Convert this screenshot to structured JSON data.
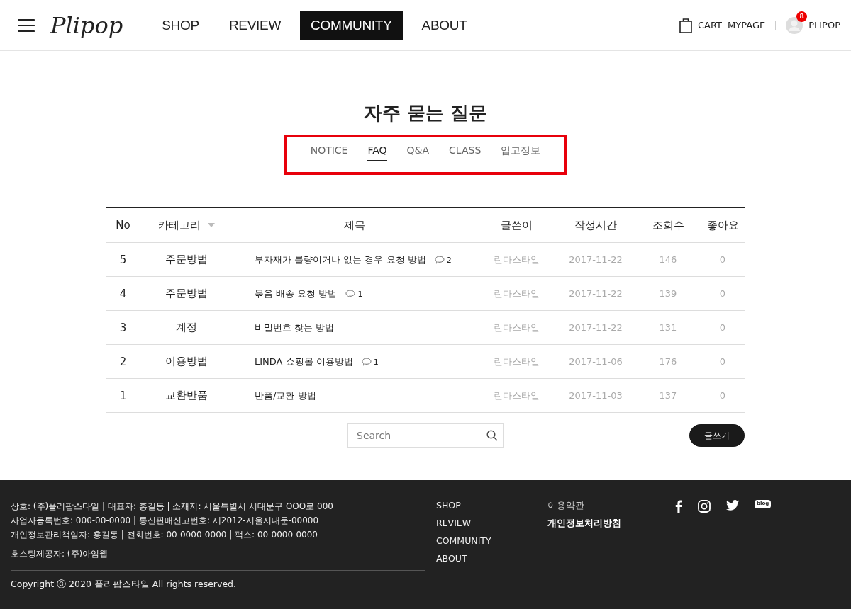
{
  "header": {
    "logo": "Plipop",
    "nav": [
      {
        "label": "SHOP",
        "selected": false
      },
      {
        "label": "REVIEW",
        "selected": false
      },
      {
        "label": "COMMUNITY",
        "selected": true
      },
      {
        "label": "ABOUT",
        "selected": false
      }
    ],
    "cart": "CART",
    "mypage": "MYPAGE",
    "user": "PLIPOP",
    "badge": "8"
  },
  "page": {
    "title": "자주 묻는 질문",
    "tabs": [
      {
        "label": "NOTICE",
        "selected": false
      },
      {
        "label": "FAQ",
        "selected": true
      },
      {
        "label": "Q&A",
        "selected": false
      },
      {
        "label": "CLASS",
        "selected": false
      },
      {
        "label": "입고정보",
        "selected": false
      }
    ]
  },
  "table": {
    "columns": [
      "No",
      "카테고리",
      "제목",
      "글쓴이",
      "작성시간",
      "조회수",
      "좋아요"
    ],
    "rows": [
      {
        "no": "5",
        "category": "주문방법",
        "title": "부자재가 불량이거나 없는 경우 요청 방법",
        "comments": "2",
        "author": "린다스타일",
        "date": "2017-11-22",
        "views": "146",
        "likes": "0"
      },
      {
        "no": "4",
        "category": "주문방법",
        "title": "묶음 배송 요청 방법",
        "comments": "1",
        "author": "린다스타일",
        "date": "2017-11-22",
        "views": "139",
        "likes": "0"
      },
      {
        "no": "3",
        "category": "계정",
        "title": "비밀번호 찾는 방법",
        "author": "린다스타일",
        "date": "2017-11-22",
        "views": "131",
        "likes": "0"
      },
      {
        "no": "2",
        "category": "이용방법",
        "title": "LINDA 쇼핑몰 이용방법",
        "comments": "1",
        "author": "린다스타일",
        "date": "2017-11-06",
        "views": "176",
        "likes": "0"
      },
      {
        "no": "1",
        "category": "교환반품",
        "title": "반품/교환 방법",
        "author": "린다스타일",
        "date": "2017-11-03",
        "views": "137",
        "likes": "0"
      }
    ]
  },
  "search": {
    "placeholder": "Search"
  },
  "write_button": "글쓰기",
  "footer": {
    "info": [
      "상호: (주)플리팝스타일 | 대표자: 홍길동 | 소재지: 서울특별시 서대문구 OOO로 000",
      "사업자등록번호: 000-00-0000 | 통신판매신고번호: 제2012-서울서대문-00000",
      "개인정보관리책임자: 홍길동 | 전화번호: 00-0000-0000 | 팩스: 00-0000-0000"
    ],
    "hosting": "호스팅제공자: (주)아임웹",
    "copyright": "Copyright ⓒ 2020 플리팝스타일 All rights reserved.",
    "nav": [
      "SHOP",
      "REVIEW",
      "COMMUNITY",
      "ABOUT"
    ],
    "policies": [
      {
        "label": "이용약관",
        "bold": false
      },
      {
        "label": "개인정보처리방침",
        "bold": true
      }
    ],
    "blog": "blog"
  }
}
